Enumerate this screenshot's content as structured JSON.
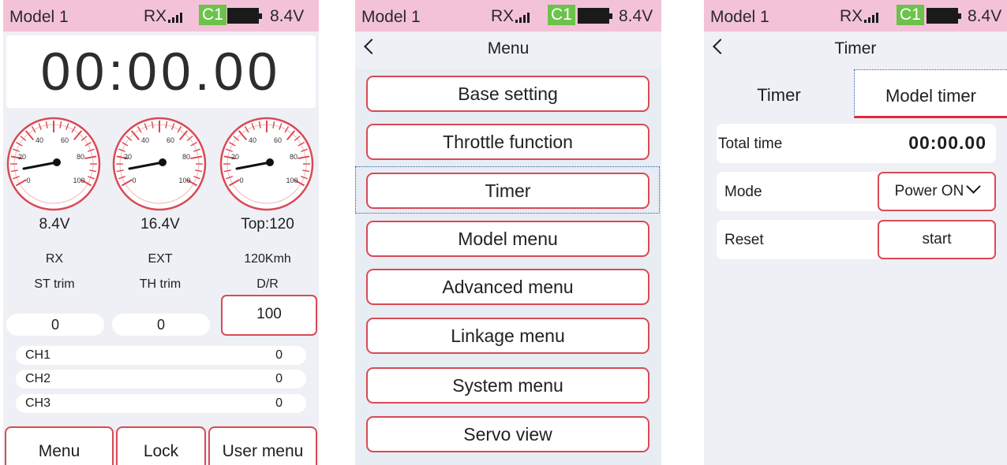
{
  "status": {
    "model": "Model 1",
    "rx_label": "RX",
    "signal_icon": "signal-bars-icon",
    "channel": "C1",
    "battery_icon": "battery-full-icon",
    "voltage": "8.4V"
  },
  "home": {
    "timer": "00:00.00",
    "gauges": [
      {
        "scale": [
          "20",
          "40",
          "60",
          "80",
          "100",
          "0"
        ],
        "reading": "8.4V",
        "name": "RX"
      },
      {
        "scale": [
          "20",
          "40",
          "60",
          "80",
          "100",
          "0"
        ],
        "reading": "16.4V",
        "name": "EXT"
      },
      {
        "scale": [
          "20",
          "40",
          "60",
          "80",
          "100",
          "0"
        ],
        "reading": "Top:120",
        "name": "120Kmh"
      }
    ],
    "trims": {
      "st_label": "ST trim",
      "st_value": "0",
      "th_label": "TH trim",
      "th_value": "0",
      "dr_label": "D/R",
      "dr_value": "100"
    },
    "channels": [
      {
        "name": "CH1",
        "value": "0"
      },
      {
        "name": "CH2",
        "value": "0"
      },
      {
        "name": "CH3",
        "value": "0"
      }
    ],
    "buttons": {
      "menu": "Menu",
      "lock": "Lock",
      "user_menu": "User menu"
    }
  },
  "menu": {
    "title": "Menu",
    "items": [
      "Base setting",
      "Throttle function",
      "Timer",
      "Model menu",
      "Advanced menu",
      "Linkage menu",
      "System menu",
      "Servo view"
    ]
  },
  "timer_screen": {
    "title": "Timer",
    "tabs": [
      "Timer",
      "Model timer"
    ],
    "total_label": "Total time",
    "total_value": "00:00.00",
    "mode_label": "Mode",
    "mode_value": "Power ON",
    "reset_label": "Reset",
    "reset_button": "start"
  },
  "colors": {
    "accent_red": "#d94a55",
    "status_pink": "#f4c2d8",
    "channel_green": "#6cc24a",
    "focus_blue": "#2c54b5"
  }
}
